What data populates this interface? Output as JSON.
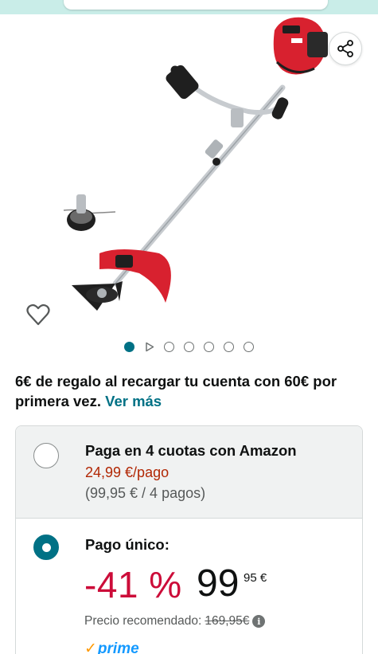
{
  "gallery": {
    "share_icon": "share-icon",
    "wishlist_icon": "heart-outline-icon",
    "product_colors": {
      "body": "#d8212f",
      "shaft": "#c7cbcf",
      "dark": "#1f1f1f"
    },
    "pager": {
      "total": 7,
      "active_index": 0,
      "video_index": 1
    }
  },
  "promo": {
    "text": "6€ de regalo al recargar tu cuenta con 60€ por primera vez.",
    "link": "Ver más"
  },
  "options": {
    "installments": {
      "title": "Paga en 4 cuotas con Amazon",
      "price": "24,99 €/pago",
      "total": "(99,95 € / 4 pagos)",
      "selected": false
    },
    "single": {
      "title": "Pago único:",
      "discount": "-41 %",
      "price_whole": "99",
      "price_fraction": "95 €",
      "rrp_label": "Precio recomendado:",
      "rrp_value": "169,95€",
      "prime_check": "✓",
      "prime_label": "prime",
      "selected": true
    }
  },
  "colors": {
    "accent": "#007185",
    "discount": "#cc0c39",
    "deal_price": "#b12704",
    "prime_blue": "#1399ff",
    "prime_check": "#ff9900"
  }
}
